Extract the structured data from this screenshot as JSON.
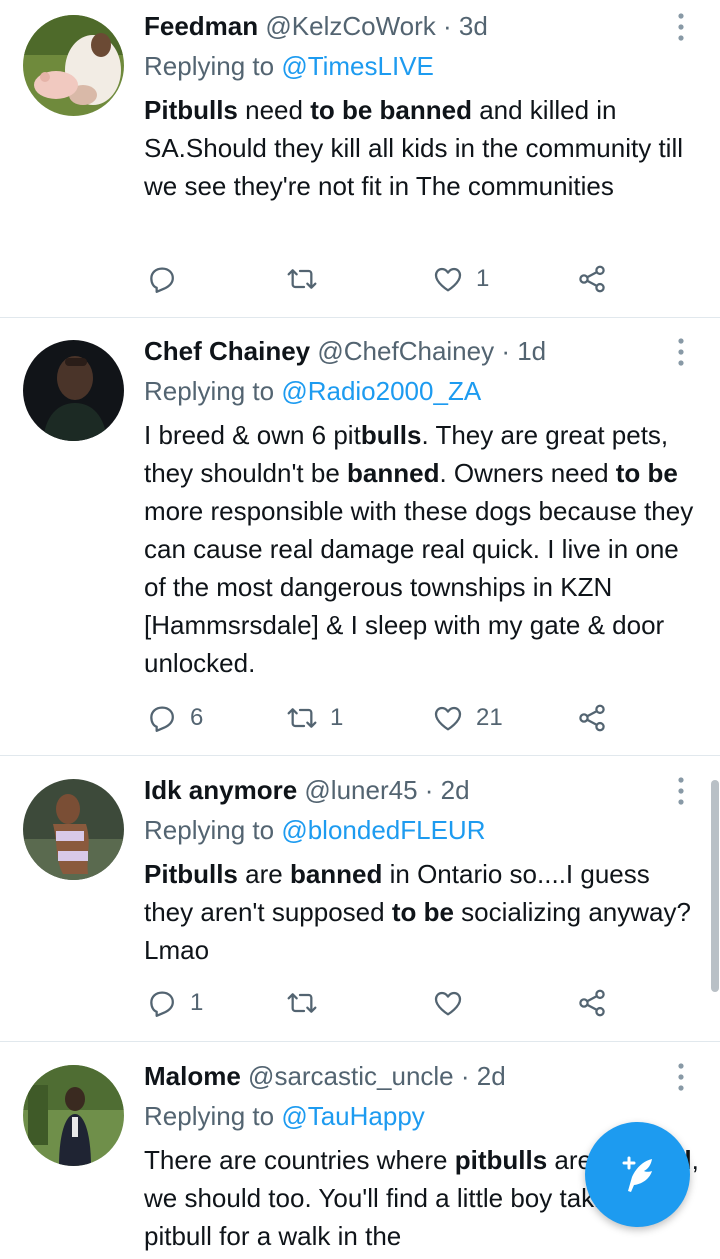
{
  "tweets": [
    {
      "name": "Feedman",
      "handle": "@KelzCoWork",
      "time": "3d",
      "replying_prefix": "Replying to ",
      "replying_to": "@TimesLIVE",
      "text_runs": [
        {
          "t": "Pitbulls",
          "b": true
        },
        {
          "t": " need ",
          "b": false
        },
        {
          "t": "to be banned",
          "b": true
        },
        {
          "t": " and killed in SA.Should they kill all kids in the community till we see they're not fit in The communities",
          "b": false
        }
      ],
      "reply_count": "",
      "retweet_count": "",
      "like_count": "1"
    },
    {
      "name": "Chef Chainey",
      "handle": "@ChefChainey",
      "time": "1d",
      "replying_prefix": "Replying to ",
      "replying_to": "@Radio2000_ZA",
      "text_runs": [
        {
          "t": "I breed & own 6 pit",
          "b": false
        },
        {
          "t": "bulls",
          "b": true
        },
        {
          "t": ". They are great pets, they shouldn't be ",
          "b": false
        },
        {
          "t": "banned",
          "b": true
        },
        {
          "t": ". Owners need ",
          "b": false
        },
        {
          "t": "to be",
          "b": true
        },
        {
          "t": " more responsible with these dogs because they can cause real damage real quick. I live in one of the most dangerous townships in KZN [Hammsrsdale] & I sleep with my gate & door unlocked.",
          "b": false
        }
      ],
      "reply_count": "6",
      "retweet_count": "1",
      "like_count": "21"
    },
    {
      "name": "Idk anymore",
      "handle": "@luner45",
      "time": "2d",
      "replying_prefix": "Replying to ",
      "replying_to": "@blondedFLEUR",
      "text_runs": [
        {
          "t": "Pitbulls",
          "b": true
        },
        {
          "t": " are ",
          "b": false
        },
        {
          "t": "banned",
          "b": true
        },
        {
          "t": " in Ontario so....I guess they aren't supposed ",
          "b": false
        },
        {
          "t": "to be",
          "b": true
        },
        {
          "t": " socializing anyway? Lmao",
          "b": false
        }
      ],
      "reply_count": "1",
      "retweet_count": "",
      "like_count": ""
    },
    {
      "name": "Malome",
      "handle": "@sarcastic_uncle",
      "time": "2d",
      "replying_prefix": "Replying to ",
      "replying_to": "@TauHappy",
      "text_runs": [
        {
          "t": "There are countries where ",
          "b": false
        },
        {
          "t": "pitbulls",
          "b": true
        },
        {
          "t": " are ",
          "b": false
        },
        {
          "t": "banned",
          "b": true
        },
        {
          "t": ", we should too. You'll find a little boy taking a pitbull for a walk in the",
          "b": false
        }
      ],
      "reply_count": "",
      "retweet_count": "",
      "like_count": ""
    }
  ],
  "icons": {
    "reply": "reply-icon",
    "retweet": "retweet-icon",
    "like": "heart-icon",
    "share": "share-icon",
    "menu": "more-vertical-icon",
    "compose": "compose-tweet-icon"
  },
  "colors": {
    "accent": "#1d9bf0",
    "text": "#0f1419",
    "secondary": "#536471",
    "divider": "#e1e8ed"
  }
}
